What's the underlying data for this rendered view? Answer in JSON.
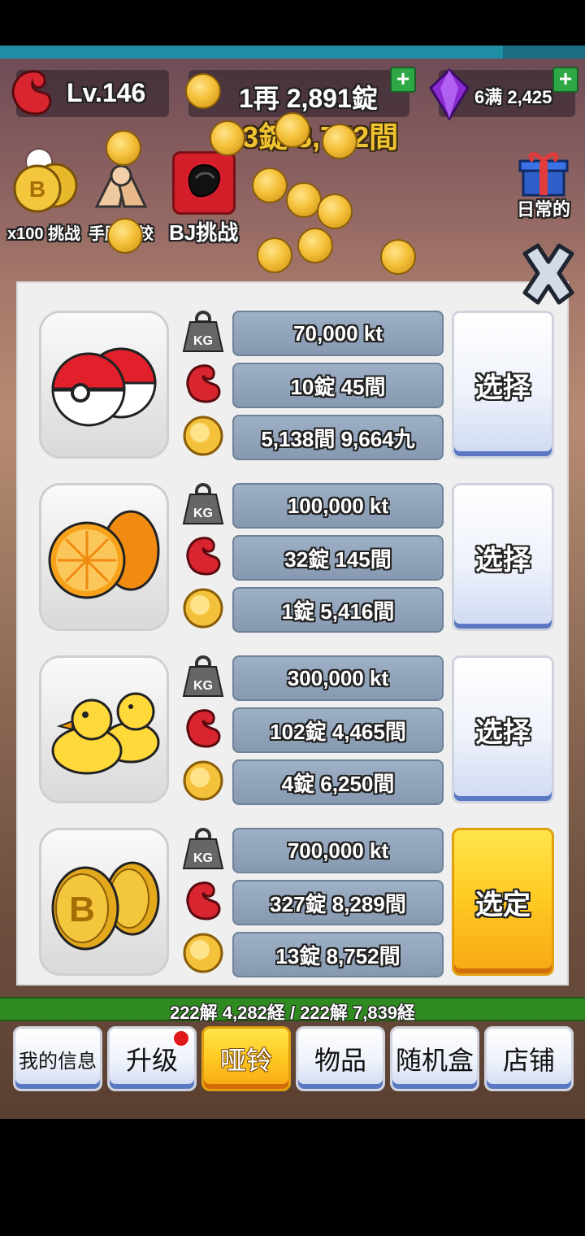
{
  "hud": {
    "level": "Lv.146",
    "gold": "1再 2,891錠",
    "gold_secondary": "3錠 3,752間",
    "gems": "6满 2,425"
  },
  "quick_actions": [
    {
      "label": "x100 挑战",
      "icon": "coin-stack-icon"
    },
    {
      "label": "手腕比较",
      "icon": "arm-wrestle-icon"
    },
    {
      "label": "BJ挑战",
      "icon": "glove-icon"
    }
  ],
  "daily": {
    "label": "日常的"
  },
  "items": [
    {
      "name": "pokeball",
      "weight": "70,000 kt",
      "power": "10錠 45間",
      "cost": "5,138間 9,664九",
      "button": "选择",
      "selected": false
    },
    {
      "name": "orange",
      "weight": "100,000 kt",
      "power": "32錠 145間",
      "cost": "1錠 5,416間",
      "button": "选择",
      "selected": false
    },
    {
      "name": "duck",
      "weight": "300,000 kt",
      "power": "102錠 4,465間",
      "cost": "4錠 6,250間",
      "button": "选择",
      "selected": false
    },
    {
      "name": "bitcoin",
      "weight": "700,000 kt",
      "power": "327錠 8,289間",
      "cost": "13錠 8,752間",
      "button": "选定",
      "selected": true
    }
  ],
  "stat_icons": {
    "weight": "KG"
  },
  "xp": {
    "text": "222解 4,282経 / 222解 7,839経",
    "progress": 0.58
  },
  "nav": [
    {
      "label": "我的信息"
    },
    {
      "label": "升级",
      "badge": true
    },
    {
      "label": "哑铃",
      "active": true
    },
    {
      "label": "物品"
    },
    {
      "label": "随机盒"
    },
    {
      "label": "店铺"
    }
  ],
  "colors": {
    "accent": "#ffcc24",
    "panel": "#efefef",
    "pill": "#8fa2ba",
    "xp": "#2f8a1f"
  }
}
